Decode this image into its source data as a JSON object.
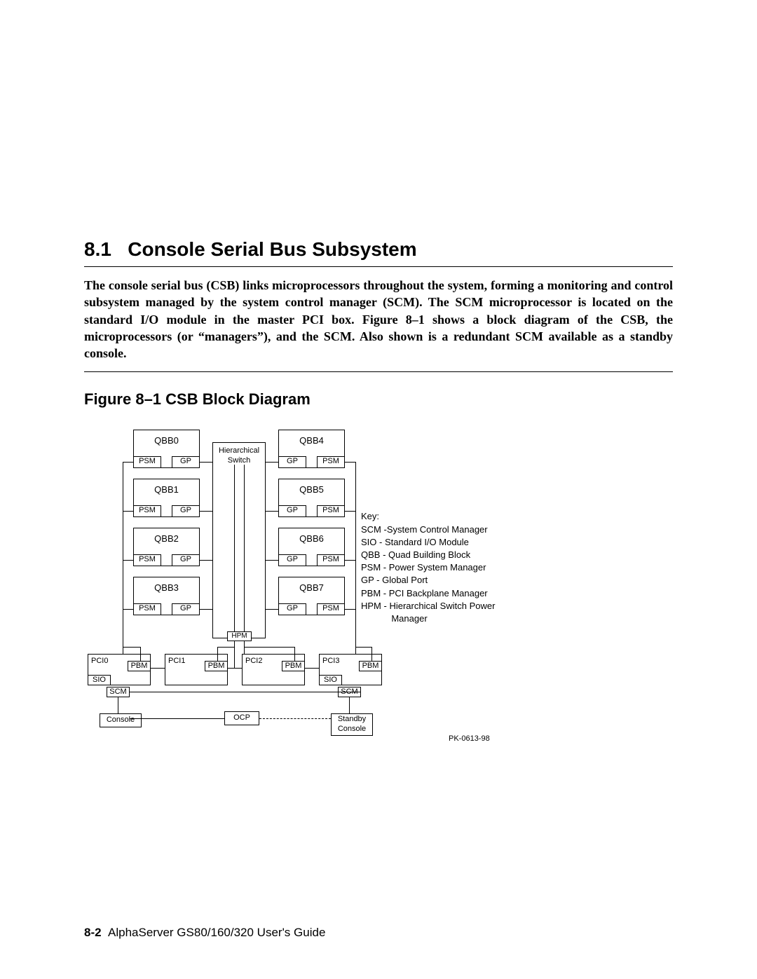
{
  "section_number": "8.1",
  "section_title": "Console Serial Bus Subsystem",
  "intro_paragraph": "The console serial bus (CSB) links microprocessors throughout the system, forming a monitoring and control subsystem managed by the system control manager (SCM). The SCM microprocessor is located on the standard I/O module in the master PCI box. Figure 8–1 shows a block diagram of the CSB, the microprocessors (or “managers”), and the SCM. Also shown is a redundant SCM available as a standby console.",
  "figure_caption": "Figure 8–1  CSB Block Diagram",
  "diagram": {
    "hswitch": "Hierarchical\nSwitch",
    "hpm": "HPM",
    "qbb_left": [
      "QBB0",
      "QBB1",
      "QBB2",
      "QBB3"
    ],
    "qbb_right": [
      "QBB4",
      "QBB5",
      "QBB6",
      "QBB7"
    ],
    "psm": "PSM",
    "gp": "GP",
    "pci": [
      "PCI0",
      "PCI1",
      "PCI2",
      "PCI3"
    ],
    "pbm": "PBM",
    "sio": "SIO",
    "scm": "SCM",
    "console": "Console",
    "standby_console": "Standby\nConsole",
    "ocp": "OCP",
    "fig_id": "PK-0613-98"
  },
  "key": {
    "heading": "Key:",
    "entries": [
      "SCM -System Control Manager",
      "SIO -  Standard I/O Module",
      "QBB - Quad Building Block",
      "PSM - Power System Manager",
      "GP -   Global Port",
      "PBM - PCI Backplane Manager",
      "HPM - Hierarchical Switch Power",
      "            Manager"
    ]
  },
  "footer": {
    "page": "8-2",
    "title": "AlphaServer GS80/160/320 User's Guide"
  }
}
